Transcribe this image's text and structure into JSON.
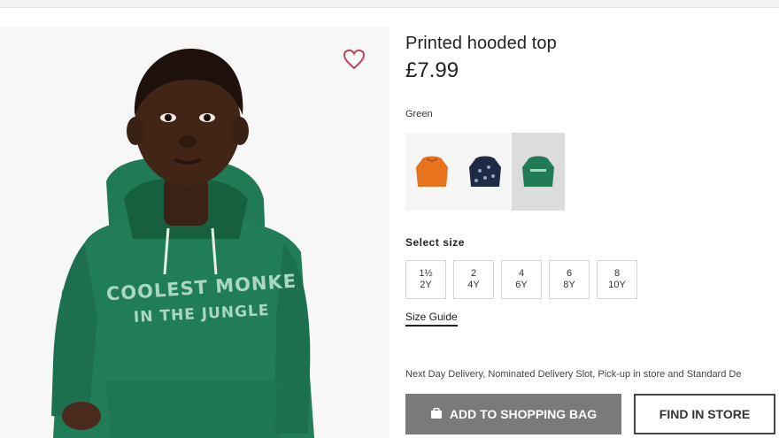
{
  "product": {
    "title": "Printed hooded top",
    "price": "£7.99",
    "selected_color": "Green",
    "hoodie_print_line1": "COOLEST MONKE",
    "hoodie_print_line2": "IN THE JUNGLE"
  },
  "colors": [
    {
      "name": "orange-hoodie",
      "hex": "#e8731e"
    },
    {
      "name": "navy-print-hoodie",
      "hex": "#1f2a44"
    },
    {
      "name": "green-hoodie",
      "hex": "#1f7a55"
    }
  ],
  "sizes": {
    "label": "Select size",
    "options": [
      {
        "top": "1½",
        "bottom": "2Y"
      },
      {
        "top": "2",
        "bottom": "4Y"
      },
      {
        "top": "4",
        "bottom": "6Y"
      },
      {
        "top": "6",
        "bottom": "8Y"
      },
      {
        "top": "8",
        "bottom": "10Y"
      }
    ]
  },
  "size_guide": "Size Guide",
  "delivery_text": "Next Day Delivery, Nominated Delivery Slot, Pick-up in store and Standard De",
  "actions": {
    "add_to_bag": "ADD TO SHOPPING BAG",
    "find_in_store": "FIND IN STORE"
  },
  "icons": {
    "favorite": "heart-outline-icon",
    "bag": "shopping-bag-icon"
  },
  "accent_colors": {
    "button_bg": "#7a7a7a",
    "heart": "#b3475f"
  }
}
